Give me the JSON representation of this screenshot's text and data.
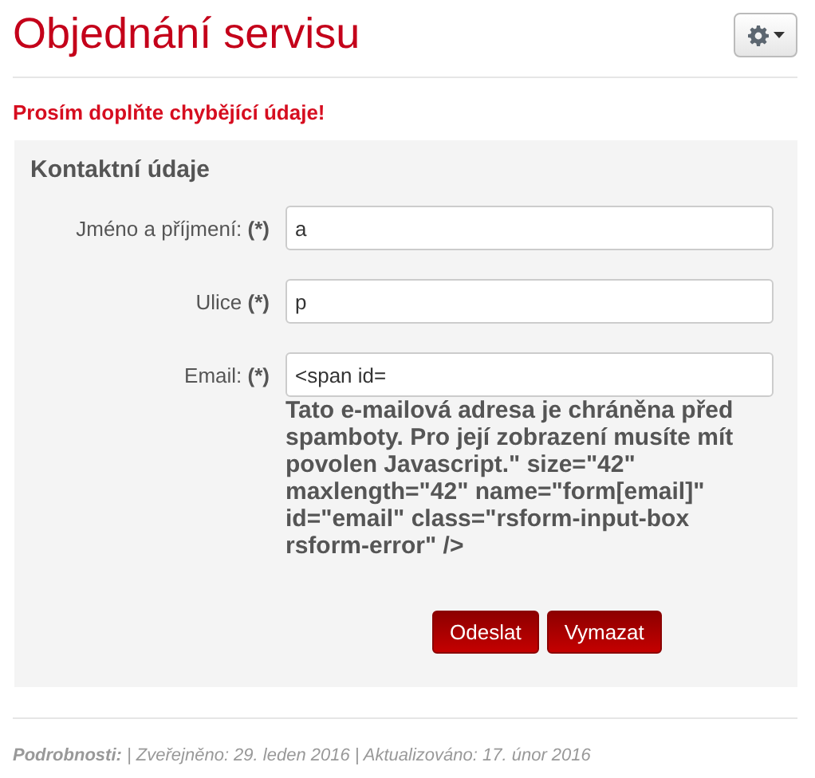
{
  "page": {
    "title": "Objednání servisu"
  },
  "error_message": "Prosím doplňte chybějící údaje!",
  "form": {
    "legend": "Kontaktní údaje",
    "fields": [
      {
        "label": "Jméno a příjmení: **(*)**",
        "value": "a"
      },
      {
        "label": "Ulice **(*)**",
        "value": "p"
      },
      {
        "label": "Email: **(*)**",
        "value": "<span id=",
        "spill_text": "Tato e-mailová adresa je chráněna před spamboty. Pro její zobrazení musíte mít povolen Javascript.\" size=\"42\" maxlength=\"42\" name=\"form[email]\" id=\"email\" class=\"rsform-input-box rsform-error\" />"
      }
    ],
    "buttons": [
      "Odeslat",
      "Vymazat"
    ]
  },
  "footer": "**Podrobnosti:** | Zveřejněno: 29. leden 2016 | Aktualizováno: 17. únor 2016"
}
